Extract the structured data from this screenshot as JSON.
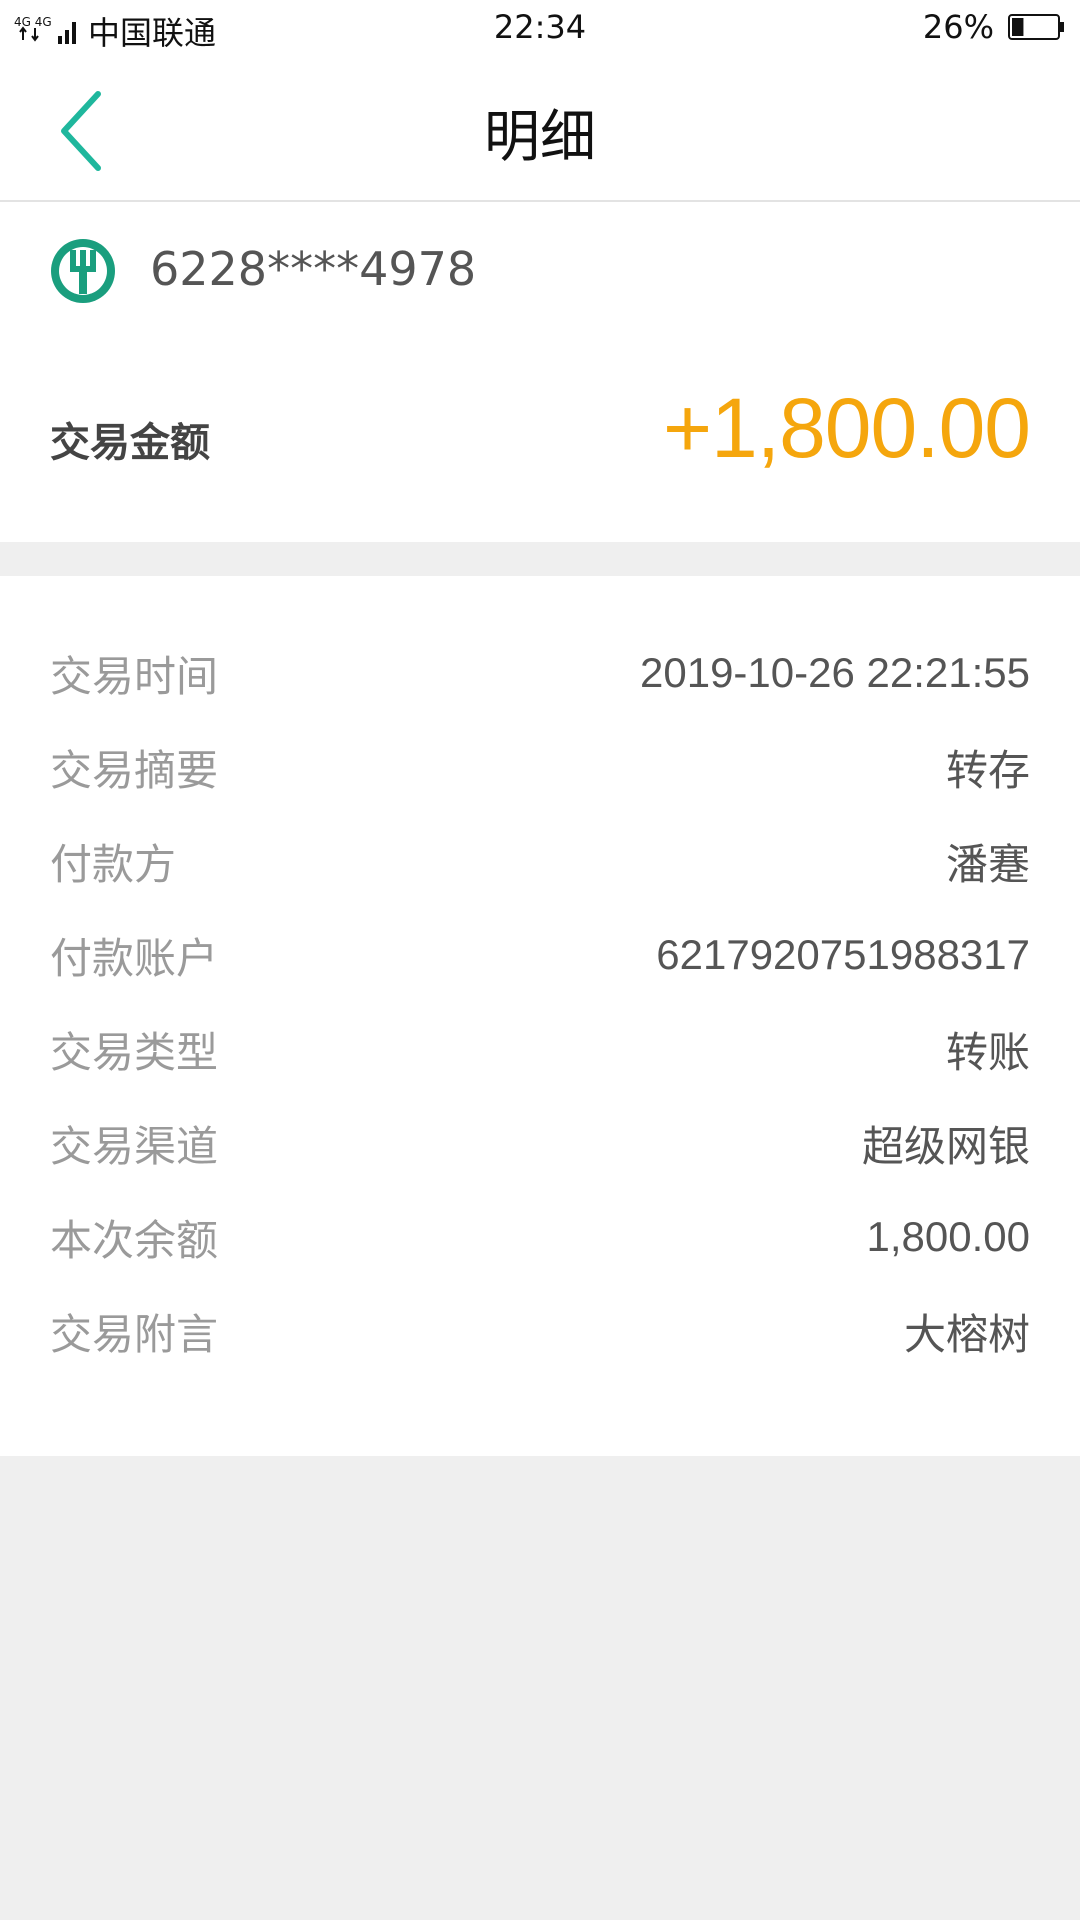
{
  "status_bar": {
    "network": "4G 4G",
    "carrier": "中国联通",
    "time": "22:34",
    "battery_percent": "26%",
    "battery_level": 0.26
  },
  "nav": {
    "title": "明细",
    "back_icon": "chevron-left-icon"
  },
  "account": {
    "bank_icon": "abc-bank-logo-icon",
    "card_number": "6228****4978",
    "amount_label": "交易金额",
    "amount": "+1,800.00"
  },
  "details": [
    {
      "label": "交易时间",
      "value": "2019-10-26 22:21:55"
    },
    {
      "label": "交易摘要",
      "value": "转存"
    },
    {
      "label": "付款方",
      "value": "潘蹇"
    },
    {
      "label": "付款账户",
      "value": "6217920751988317"
    },
    {
      "label": "交易类型",
      "value": "转账"
    },
    {
      "label": "交易渠道",
      "value": "超级网银"
    },
    {
      "label": "本次余额",
      "value": "1,800.00"
    },
    {
      "label": "交易附言",
      "value": "大榕树"
    }
  ],
  "colors": {
    "accent": "#1fb79d",
    "amount": "#f5a60d",
    "background": "#efefef"
  }
}
